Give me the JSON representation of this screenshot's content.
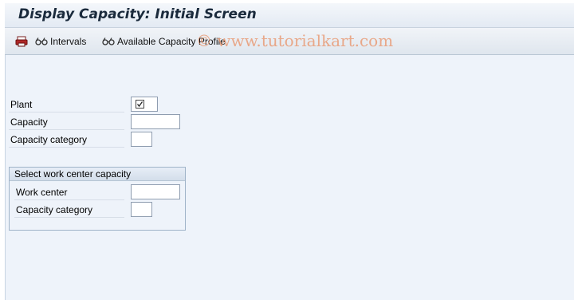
{
  "window": {
    "title": "Display Capacity: Initial Screen"
  },
  "toolbar": {
    "items": [
      {
        "label": "",
        "icon": "print-layout-icon"
      },
      {
        "label": "Intervals",
        "icon": "glasses-icon"
      },
      {
        "label": "Available Capacity Profile",
        "icon": "glasses-icon"
      }
    ]
  },
  "watermark": {
    "text": "© www.tutorialkart.com"
  },
  "form": {
    "plant": {
      "label": "Plant",
      "value": "",
      "required": true
    },
    "capacity": {
      "label": "Capacity",
      "value": ""
    },
    "capacity_category": {
      "label": "Capacity category",
      "value": ""
    }
  },
  "group": {
    "title": "Select work center capacity",
    "work_center": {
      "label": "Work center",
      "value": ""
    },
    "capacity_category": {
      "label": "Capacity category",
      "value": ""
    }
  },
  "colors": {
    "background": "#eef3fa",
    "title_text": "#1a2a3c",
    "watermark": "#e8966e",
    "field_border": "#8f9db0"
  }
}
